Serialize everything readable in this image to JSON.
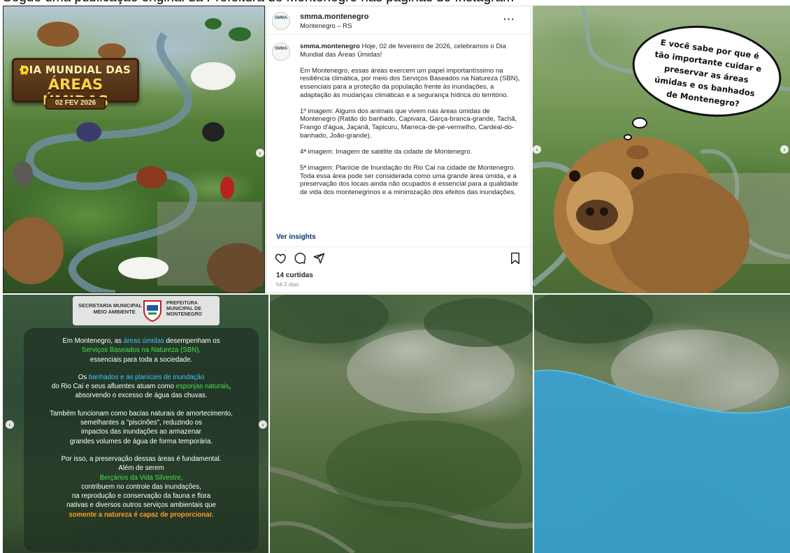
{
  "header": {
    "text": "Segue uma publicação original da Prefeitura de Montenegro nas páginas do Instagram"
  },
  "poster": {
    "title_line1": "DIA MUNDIAL DAS",
    "title_line2": "ÁREAS ÚMIDAS",
    "date": "02 FEV 2026"
  },
  "post": {
    "username": "smma.montenegro",
    "location": "Montenegro – RS",
    "avatar_text": "SMMA",
    "more": "···",
    "caption_user": "smma.montenegro",
    "caption": [
      "Hoje, 02 de fevereiro de 2026, celebramos o Dia Mundial das Áreas Úmidas!",
      "Em Montenegro, essas áreas exercem um papel importantíssimo na resiliência climática, por meio dos Serviços Baseados na Natureza (SBN), essenciais para a proteção da população frente às inundações, a adaptação às mudanças climáticas e a segurança hídrica do território.",
      "1º imagem: Alguns dos animais que vivem nas áreas úmidas de Montenegro (Ratão do banhado, Capivara, Garça-branca-grande, Tachã, Frango d'água, Jaçanã, Tapicuru, Marreca-de-pé-vermelho, Cardeal-do-banhado, João-grande).",
      "4ª imagem: Imagem de satélite da cidade de Montenegro.",
      "5ª imagem: Planície de Inundação do Rio Caí na cidade de Montenegro. Toda essa área pode ser considerada como uma grande área úmida, e a preservação dos locais ainda não ocupados é essencial para a qualidade de vida dos montenegrinos e a minimização dos efeitos das inundações."
    ],
    "insights": "Ver insights",
    "likes": "14 curtidas",
    "when": "há 2 dias"
  },
  "thought": {
    "lines": [
      "E você sabe por que é",
      "tão importante cuidar e",
      "preservar as áreas",
      "úmidas e os banhados",
      "de Montenegro?"
    ]
  },
  "info": {
    "logo_left": [
      "SECRETARIA MUNICIPAL DE",
      "MEIO AMBIENTE"
    ],
    "logo_right": [
      "PREFEITURA",
      "MUNICIPAL DE",
      "MONTENEGRO"
    ],
    "p1_a": "Em Montenegro, as ",
    "p1_b": "áreas úmidas",
    "p1_c": " desempenham os",
    "p1_d": "Serviços Baseados na Natureza (SBN),",
    "p1_e": "essenciais para toda a sociedade.",
    "p2_a": "Os ",
    "p2_b": "banhados e as planícies de inundação",
    "p2_c": "do Rio Caí e seus afluentes atuam como ",
    "p2_d": "esponjas naturais",
    "p2_e": ",",
    "p2_f": "absorvendo o excesso de água das chuvas.",
    "p3_a": "Também funcionam como bacias naturais de amortecimento,",
    "p3_b": "semelhantes a \"piscinões\", reduzindo os",
    "p3_c": "impactos das inundações ao armazenar",
    "p3_d": "grandes volumes de água de forma temporária.",
    "p4_a": "Por isso, a preservação dessas áreas é fundamental.",
    "p4_b": "Além de serem",
    "p4_c": "Berçários da Vida Silvestre,",
    "p4_d": "contribuem no controle das inundações,",
    "p4_e": "na reprodução e conservação da fauna e flora",
    "p4_f": "nativas e diversos outros serviços ambientais que",
    "p4_g": "somente a natureza é capaz de proporcionar."
  }
}
